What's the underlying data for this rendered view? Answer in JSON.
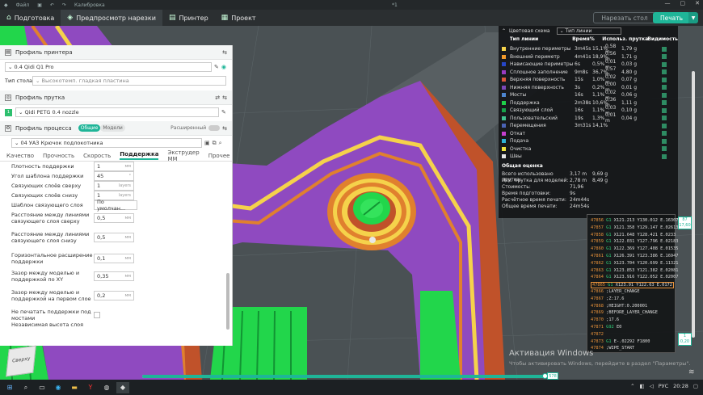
{
  "titlebar": {
    "file": "Файл",
    "calibration": "Калибровка",
    "counter": "*1"
  },
  "tabs": [
    {
      "label": "Подготовка",
      "icon": "home-icon"
    },
    {
      "label": "Предпросмотр нарезки",
      "icon": "slice-preview-icon"
    },
    {
      "label": "Принтер",
      "icon": "printer-icon"
    },
    {
      "label": "Проект",
      "icon": "project-icon"
    }
  ],
  "actions": {
    "slice_plate": "Нарезать стол",
    "print": "Печать"
  },
  "printer": {
    "header": "Профиль принтера",
    "profile": "0.4 Qidi Q1 Pro",
    "bed_label": "Тип стола",
    "bed_value": "Высокотемп. гладкая пластина"
  },
  "filament": {
    "header": "Профиль прутка",
    "value": "Qidi PETG  0.4 nozzle",
    "index": "1"
  },
  "process": {
    "header": "Профиль процесса",
    "toggle_general": "Общие",
    "toggle_models": "Модели",
    "advanced": "Расширенный",
    "profile": "04 УАЗ Крючок подлокотника"
  },
  "subtabs": [
    "Качество",
    "Прочность",
    "Скорость",
    "Поддержка",
    "Экструдер ММ",
    "Прочее"
  ],
  "active_subtab": "Поддержка",
  "params": [
    {
      "label": "Плотность поддержки",
      "value": "1",
      "unit": "мм"
    },
    {
      "label": "Угол шаблона поддержки",
      "value": "45",
      "unit": "°"
    },
    {
      "label": "Связующих слоёв сверху",
      "value": "1",
      "unit": "layers"
    },
    {
      "label": "Связующих слоёв снизу",
      "value": "1",
      "unit": "layers"
    },
    {
      "label": "Шаблон связующего слоя",
      "value": "По умолчан...",
      "unit": ""
    },
    {
      "label": "Расстояние между линиями связующего слоя сверху",
      "value": "0,5",
      "unit": "мм"
    },
    {
      "label": "Расстояние между линиями связующего слоя снизу",
      "value": "0,5",
      "unit": "мм"
    },
    {
      "label": "Горизонтальное расширение поддержки",
      "value": "0,1",
      "unit": "мм"
    },
    {
      "label": "Зазор между моделью и поддержкой по XY",
      "value": "0,35",
      "unit": "мм"
    },
    {
      "label": "Зазор между моделью и поддержкой на первом слое",
      "value": "0,2",
      "unit": "мм"
    },
    {
      "label": "Не печатать поддержки под мостами",
      "value": "",
      "unit": ""
    },
    {
      "label": "Независимая высота слоя",
      "value": "",
      "unit": ""
    }
  ],
  "legend": {
    "title": "Цветовая схема",
    "scheme": "Тип линии",
    "headers": {
      "type": "Тип линии",
      "time": "Время",
      "pct": "%",
      "usage": "Использ. прутка",
      "visibility": "Видимость"
    },
    "rows": [
      {
        "name": "Внутренние периметры",
        "time": "3m45s",
        "pct": "15,1%",
        "m": "0,58 m",
        "g": "1,79 g",
        "color": "#f5d24b"
      },
      {
        "name": "Внешний периметр",
        "time": "4m41s",
        "pct": "18,9%",
        "m": "0,56 m",
        "g": "1,71 g",
        "color": "#f39a2b"
      },
      {
        "name": "Нависающие периметры",
        "time": "6s",
        "pct": "0,5%",
        "m": "0,01 m",
        "g": "0,03 g",
        "color": "#2646c8"
      },
      {
        "name": "Сплошное заполнение",
        "time": "9m8s",
        "pct": "36,7%",
        "m": "1,57 m",
        "g": "4,80 g",
        "color": "#9a3bc2"
      },
      {
        "name": "Верхняя поверхность",
        "time": "15s",
        "pct": "1,0%",
        "m": "0,02 m",
        "g": "0,07 g",
        "color": "#e0563b"
      },
      {
        "name": "Нижняя поверхность",
        "time": "3s",
        "pct": "0,2%",
        "m": "0,00 m",
        "g": "0,01 g",
        "color": "#7c48b9"
      },
      {
        "name": "Мосты",
        "time": "16s",
        "pct": "1,1%",
        "m": "0,02 m",
        "g": "0,06 g",
        "color": "#4d86d1"
      },
      {
        "name": "Поддержка",
        "time": "2m38s",
        "pct": "10,6%",
        "m": "0,36 m",
        "g": "1,11 g",
        "color": "#1fd14a"
      },
      {
        "name": "Связующий слой",
        "time": "16s",
        "pct": "1,1%",
        "m": "0,03 m",
        "g": "0,10 g",
        "color": "#17a34a"
      },
      {
        "name": "Пользовательский",
        "time": "19s",
        "pct": "1,3%",
        "m": "0,01 m",
        "g": "0,04 g",
        "color": "#42c48f"
      },
      {
        "name": "Перемещения",
        "time": "3m31s",
        "pct": "14,1%",
        "m": "",
        "g": "",
        "color": "#4a63b5"
      },
      {
        "name": "Откат",
        "time": "",
        "pct": "",
        "m": "",
        "g": "",
        "color": "#c63fcf"
      },
      {
        "name": "Подача",
        "time": "",
        "pct": "",
        "m": "",
        "g": "",
        "color": "#2fb3d7"
      },
      {
        "name": "Очистка",
        "time": "",
        "pct": "",
        "m": "",
        "g": "",
        "color": "#f0e33d"
      },
      {
        "name": "Швы",
        "time": "",
        "pct": "",
        "m": "",
        "g": "",
        "color": "#e6e6e6"
      }
    ],
    "summary_title": "Общая оценка",
    "summary": [
      {
        "label": "Всего использовано прутка:",
        "value": "3,17 m",
        "extra": "9,69 g"
      },
      {
        "label": "Исп. прутка для моделей:",
        "value": "2,78 m",
        "extra": "8,49 g"
      },
      {
        "label": "Стоимость:",
        "value": "71,96",
        "extra": ""
      },
      {
        "label": "Время подготовки:",
        "value": "9s",
        "extra": ""
      },
      {
        "label": "Расчётное время печати:",
        "value": "24m44s",
        "extra": ""
      },
      {
        "label": "Общее время печати:",
        "value": "24m54s",
        "extra": ""
      }
    ]
  },
  "gcode": [
    {
      "ln": "47856",
      "cmd": "G1",
      "args": "X121.213 Y130.012 E.16307"
    },
    {
      "ln": "47857",
      "cmd": "G1",
      "args": "X121.358 Y129.147 E.02613"
    },
    {
      "ln": "47858",
      "cmd": "G1",
      "args": "X121.648 Y128.421 E.0233"
    },
    {
      "ln": "47859",
      "cmd": "G1",
      "args": "X122.031 Y127.796 E.02183"
    },
    {
      "ln": "47860",
      "cmd": "G1",
      "args": "X122.369 Y127.408 E.01535"
    },
    {
      "ln": "47861",
      "cmd": "G1",
      "args": "X126.391 Y123.386 E.16947"
    },
    {
      "ln": "47862",
      "cmd": "G1",
      "args": "X123.704 Y120.699 E.11321"
    },
    {
      "ln": "47863",
      "cmd": "G1",
      "args": "X123.853 Y121.382 E.02081"
    },
    {
      "ln": "47864",
      "cmd": "G1",
      "args": "X123.916 Y122.052 E.02007"
    },
    {
      "ln": "47865",
      "cmd": "G1",
      "args": "X123.91 Y122.63 E.0172"
    },
    {
      "ln": "47866",
      "cmd": "",
      "args": ";LAYER_CHANGE"
    },
    {
      "ln": "47867",
      "cmd": "",
      "args": ";Z:17.6"
    },
    {
      "ln": "47868",
      "cmd": "",
      "args": ";HEIGHT:0.200001"
    },
    {
      "ln": "47869",
      "cmd": "",
      "args": ";BEFORE_LAYER_CHANGE"
    },
    {
      "ln": "47870",
      "cmd": "",
      "args": ";17.6"
    },
    {
      "ln": "47871",
      "cmd": "G92",
      "args": "E0"
    },
    {
      "ln": "47872",
      "cmd": "",
      "args": ""
    },
    {
      "ln": "47873",
      "cmd": "G1",
      "args": "E-.02292 F1800"
    },
    {
      "ln": "47874",
      "cmd": "",
      "args": ";WIPE_START"
    }
  ],
  "layer_slider": {
    "top_layer": "87",
    "top_height": "17,60",
    "bottom_layer": "1",
    "bottom_height": "0,20"
  },
  "move_slider": {
    "value": "578"
  },
  "view_cube": {
    "label": "Сверху"
  },
  "watermark": {
    "title": "Активация Windows",
    "text": "Чтобы активировать Windows, перейдите в раздел \"Параметры\"."
  },
  "taskbar": {
    "lang": "РУС",
    "time": "20:28"
  }
}
